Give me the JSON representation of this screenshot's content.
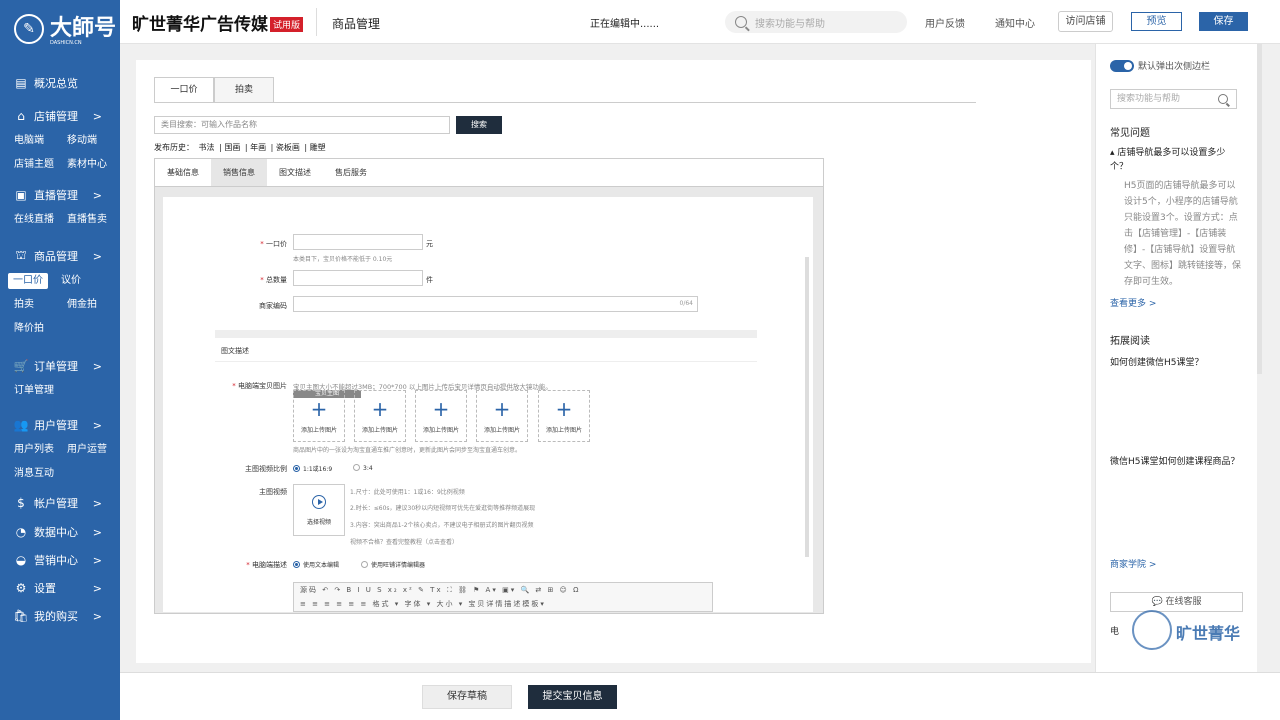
{
  "logo": {
    "text": "大師号",
    "sub": "DASHICN.CN"
  },
  "sidebar": {
    "groups": [
      {
        "label": "概况总览",
        "icon": "overview-icon",
        "chevron": "",
        "subs": []
      },
      {
        "label": "店铺管理",
        "icon": "home-icon",
        "chevron": ">",
        "subs": [
          "电脑端",
          "移动端",
          "店铺主题",
          "素材中心"
        ]
      },
      {
        "label": "直播管理",
        "icon": "live-icon",
        "chevron": ">",
        "subs": [
          "在线直播",
          "直播售卖"
        ]
      },
      {
        "label": "商品管理",
        "icon": "shop-icon",
        "chevron": ">",
        "subs": [
          "一口价",
          "议价",
          "拍卖",
          "佣金拍",
          "降价拍"
        ]
      },
      {
        "label": "订单管理",
        "icon": "cart-icon",
        "chevron": ">",
        "subs": [
          "订单管理"
        ]
      },
      {
        "label": "用户管理",
        "icon": "users-icon",
        "chevron": ">",
        "subs": [
          "用户列表",
          "用户运营",
          "消息互动"
        ]
      },
      {
        "label": "帐户管理",
        "icon": "dollar-icon",
        "chevron": ">",
        "subs": []
      },
      {
        "label": "数据中心",
        "icon": "pie-icon",
        "chevron": ">",
        "subs": []
      },
      {
        "label": "营销中心",
        "icon": "android-icon",
        "chevron": ">",
        "subs": []
      },
      {
        "label": "设置",
        "icon": "gear-icon",
        "chevron": ">",
        "subs": []
      },
      {
        "label": "我的购买",
        "icon": "basket-icon",
        "chevron": ">",
        "subs": []
      }
    ]
  },
  "header": {
    "brand": "旷世菁华广告传媒",
    "trial_badge": "试用版",
    "module": "商品管理",
    "editing": "正在编辑中......",
    "search_placeholder": "搜索功能与帮助",
    "feedback": "用户反馈",
    "notifications": "通知中心",
    "visit_store": "访问店铺",
    "preview": "预览",
    "save": "保存"
  },
  "main": {
    "tabs": [
      "一口价",
      "拍卖"
    ],
    "category_search_placeholder": "类目搜索：可输入作品名称",
    "search_button": "搜索",
    "history_label": "发布历史：",
    "history_items": [
      "书法",
      "国画",
      "年画",
      "瓷板画",
      "雕塑"
    ],
    "subtabs": [
      "基础信息",
      "销售信息",
      "图文描述",
      "售后服务"
    ],
    "form": {
      "price_label": "一口价",
      "price_unit": "元",
      "price_hint": "本类目下，宝贝价格不能低于 0.10元",
      "stock_label": "总数量",
      "stock_unit": "件",
      "code_label": "商家编码",
      "code_counter": "0/64",
      "section_title": "图文描述",
      "pc_image_label": "电脑端宝贝图片",
      "pc_image_hint": "宝贝主图大小不能超过3MB；700*700 以上图片上传后宝贝详情页自动提供放大镜功能。",
      "main_image_tag": "宝贝主图",
      "upload_text": "添加上传图片",
      "upload_note": "商品图片中的一张设为淘宝直通车推广创意时，更新此图片会同步至淘宝直通车创意。",
      "ratio_label": "主图视频比例",
      "ratio_opt1": "1:1或16:9",
      "ratio_opt2": "3:4",
      "video_label": "主图视频",
      "video_btn": "选择视频",
      "video_note1": "1.尺寸：此处可使用1：1或16：9比例视频",
      "video_note2": "2.时长：≤60s，建议30秒以内短视频可优先在爱逛街等推荐频道展现",
      "video_note3": "3.内容：突出商品1-2个核心卖点，不建议电子相册式的图片翻页视频",
      "video_note4": "视频不合格？查看完整教程（点击查看）",
      "desc_label": "电脑端描述",
      "desc_opt1": "使用文本编辑",
      "desc_opt2": "使用旺铺详情编辑器",
      "editor_row1": "源码  ↶ ↷  B I U S x₂ x²  ✎ Tx  ⛶ ⛓ ⚑  A▾ ▣▾  🔍 ⇄  ⊞  ☺ Ω",
      "editor_row2": "≡ ≡ ≡ ≡ ≡ ≡   格式 ▾   字体 ▾   大小 ▾   宝贝详情描述模板▾"
    }
  },
  "bottom": {
    "draft": "保存草稿",
    "submit": "提交宝贝信息"
  },
  "right_panel": {
    "toggle_label": "默认弹出次侧边栏",
    "search_placeholder": "搜索功能与帮助",
    "faq_title": "常见问题",
    "faq_q": "店铺导航最多可以设置多少个？",
    "faq_a": "H5页面的店铺导航最多可以设计5个，小程序的店铺导航只能设置3个。设置方式：点击【店铺管理】-【店铺装修】-【店铺导航】设置导航文字、图标】跳转链接等，保存即可生效。",
    "see_more": "查看更多 >",
    "ext_title": "拓展阅读",
    "ext_items": [
      "如何创建微信H5课堂？",
      "微信H5课堂如何创建课程商品？"
    ],
    "academy": "商家学院 >",
    "online_service": "💬 在线客服",
    "tel": "电",
    "watermark": "旷世菁华"
  }
}
